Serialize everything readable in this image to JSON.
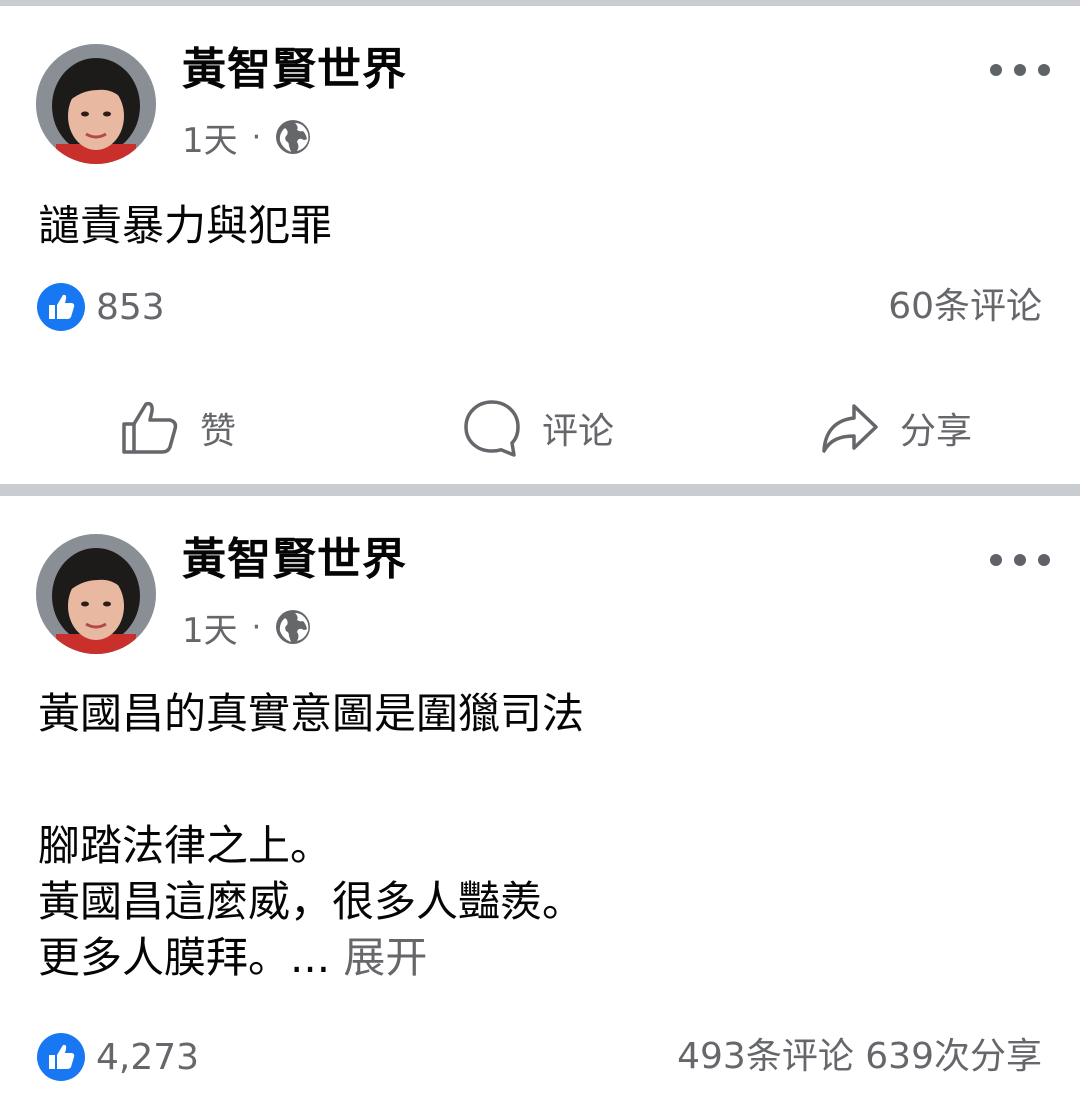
{
  "posts": [
    {
      "author": "黃智賢世界",
      "time": "1天",
      "separator": "·",
      "privacy_icon": "globe-icon",
      "text_lines": [
        "譴責暴力與犯罪"
      ],
      "reactions_count": "853",
      "comments_count": "60条评论",
      "actions": {
        "like": "赞",
        "comment": "评论",
        "share": "分享"
      }
    },
    {
      "author": "黃智賢世界",
      "time": "1天",
      "separator": "·",
      "privacy_icon": "globe-icon",
      "text_lines": [
        "黃國昌的真實意圖是圍獵司法",
        "",
        "腳踏法律之上。",
        "黃國昌這麼威，很多人豔羨。",
        "更多人膜拜。..."
      ],
      "see_more": "展开",
      "reactions_count": "4,273",
      "comments_count": "493条评论",
      "shares_count": "639次分享"
    }
  ],
  "colors": {
    "feed_background": "#c9ccd1",
    "card_background": "#ffffff",
    "primary_text": "#050505",
    "secondary_text": "#65676b",
    "like_blue": "#1877f2"
  }
}
